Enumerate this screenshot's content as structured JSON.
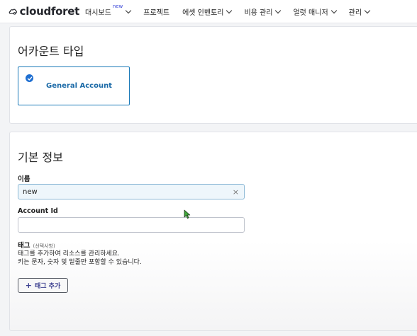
{
  "app": {
    "logo_text": "cloudforet"
  },
  "nav": {
    "items": [
      {
        "label": "대시보드",
        "badge": "new",
        "has_chevron": true
      },
      {
        "label": "프로젝트",
        "has_chevron": false
      },
      {
        "label": "에셋 인벤토리",
        "has_chevron": true
      },
      {
        "label": "비용 관리",
        "has_chevron": true
      },
      {
        "label": "얼럿 매니저",
        "has_chevron": true
      },
      {
        "label": "관리",
        "has_chevron": true
      }
    ]
  },
  "account_type": {
    "title": "어카운트 타입",
    "option_label": "General Account",
    "selected": true
  },
  "basic_info": {
    "title": "기본 정보",
    "name_label": "이름",
    "name_value": "new",
    "account_id_label": "Account Id",
    "account_id_value": "",
    "tag_label": "태그",
    "tag_optional": "(선택사항)",
    "tag_help_line1": "태그를 추가하여 리소스를 관리하세요.",
    "tag_help_line2": "키는 문자, 숫자 및 밑줄만 포함할 수 있습니다.",
    "add_tag_label": "태그 추가"
  },
  "colors": {
    "accent": "#1b7ab8",
    "primary": "#1f6fd1",
    "button_text": "#3b3f8f"
  }
}
